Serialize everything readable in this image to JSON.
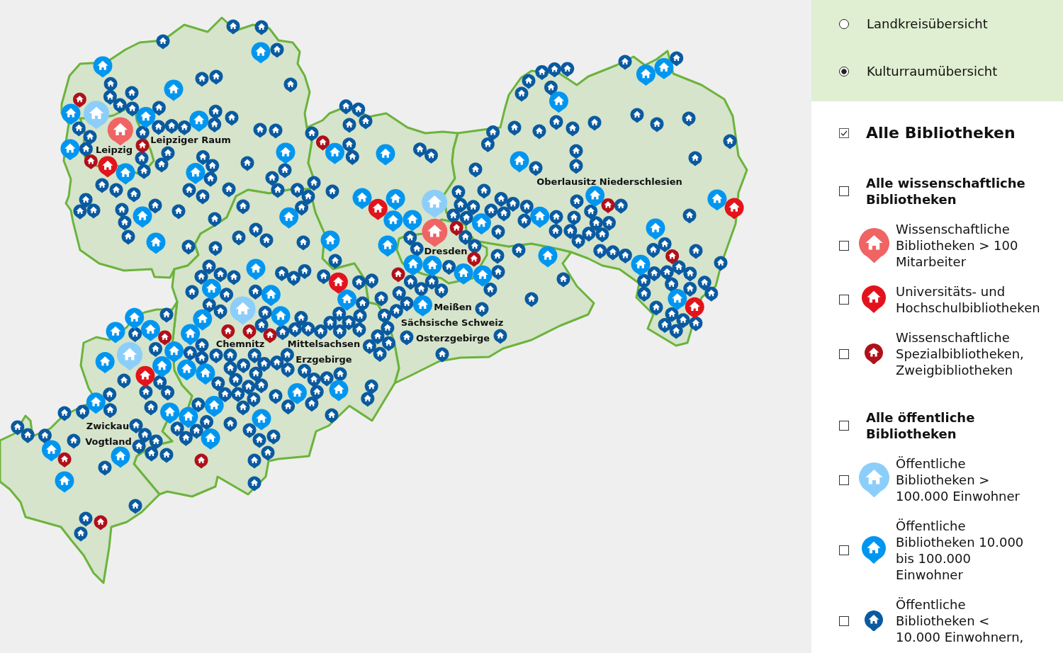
{
  "map": {
    "labels": [
      "Leipziger Raum",
      "Leipzig",
      "Oberlausitz Niederschlesien",
      "Dresden",
      "Meißen",
      "Sächsische Schweiz",
      "Chemnitz",
      "Mittelsachsen",
      "Osterzgebirge",
      "Erzgebirge",
      "Zwickau",
      "Vogtland"
    ]
  },
  "sidebar": {
    "view_modes": [
      {
        "label": "Landkreisübersicht",
        "selected": false
      },
      {
        "label": "Kulturraumübersicht",
        "selected": true
      }
    ],
    "filters": [
      {
        "kind": "master",
        "lines": [
          "Alle Bibliotheken"
        ],
        "checked": true
      },
      {
        "kind": "group",
        "lines": [
          "Alle wissenschaftliche",
          "Bibliotheken"
        ],
        "checked": false
      },
      {
        "kind": "large-pin",
        "lines": [
          "Wissenschaftliche",
          "Bibliotheken > 100",
          "Mitarbeiter"
        ],
        "checked": false,
        "color": "#f06464"
      },
      {
        "kind": "medium-pin",
        "lines": [
          "Universitäts- und",
          "Hochschulbibliotheken"
        ],
        "checked": false,
        "color": "#e3131b"
      },
      {
        "kind": "small-pin",
        "lines": [
          "Wissenschaftliche",
          "Spezialbibliotheken,",
          "Zweigbibliotheken"
        ],
        "checked": false,
        "color": "#b0101a"
      },
      {
        "kind": "group",
        "lines": [
          "Alle öffentliche",
          "Bibliotheken"
        ],
        "checked": false
      },
      {
        "kind": "large-pin",
        "lines": [
          "Öffentliche",
          "Bibliotheken >",
          "100.000 Einwohner"
        ],
        "checked": false,
        "color": "#8ccefa"
      },
      {
        "kind": "medium-pin",
        "lines": [
          "Öffentliche",
          "Bibliotheken 10.000",
          "bis 100.000",
          "Einwohner"
        ],
        "checked": false,
        "color": "#0096f0"
      },
      {
        "kind": "small-pin",
        "lines": [
          "Öffentliche",
          "Bibliotheken <",
          "10.000 Einwohnern,"
        ],
        "checked": false,
        "color": "#0a5aa0"
      }
    ]
  }
}
